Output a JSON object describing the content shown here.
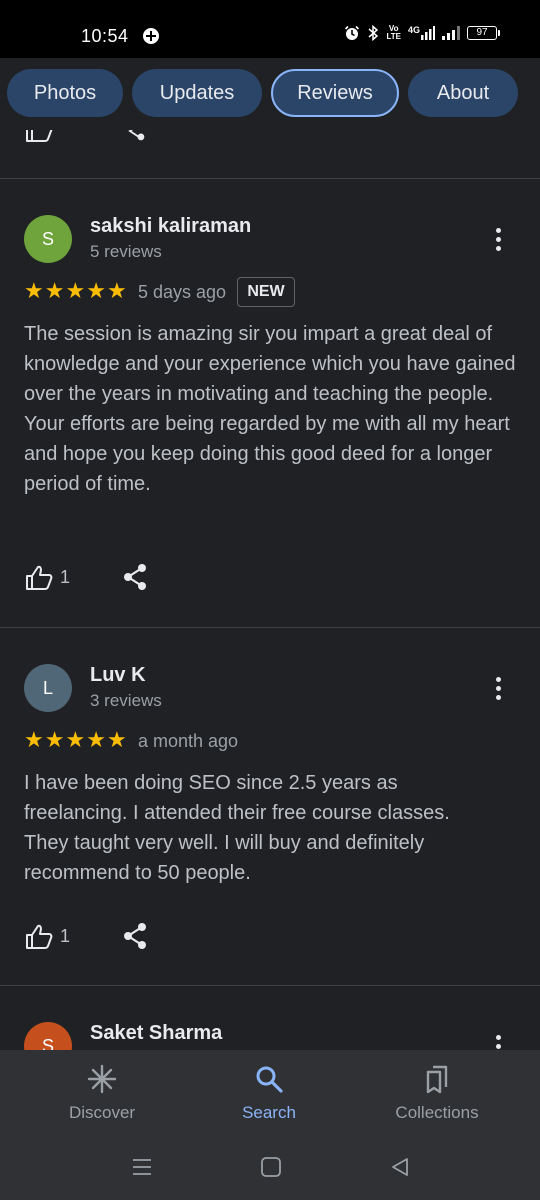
{
  "status_bar": {
    "time": "10:54",
    "volte_label_top": "Vo",
    "volte_label_bottom": "LTE",
    "network": "4G",
    "battery": "97"
  },
  "tabs": [
    {
      "label": "Photos",
      "active": false
    },
    {
      "label": "Updates",
      "active": false
    },
    {
      "label": "Reviews",
      "active": true
    },
    {
      "label": "About",
      "active": false
    }
  ],
  "prev_review": {
    "like_count": "1"
  },
  "reviews": [
    {
      "initial": "S",
      "avatar_color": "#6fa33b",
      "author": "sakshi kaliraman",
      "review_count": "5 reviews",
      "rating": 5,
      "when": "5 days ago",
      "badge": "NEW",
      "text": "The session is amazing sir you impart a great deal of knowledge and your experience which you have gained over the years in motivating and teaching the people.\nYour efforts are being regarded by me with all my heart and hope you keep doing this good deed for a longer period of time.",
      "like_count": "1"
    },
    {
      "initial": "L",
      "avatar_color": "#4f6777",
      "author": "Luv K",
      "review_count": "3 reviews",
      "rating": 5,
      "when": "a month ago",
      "text": "I have been doing SEO since 2.5 years as freelancing. I attended their free course classes. They taught very well. I will buy and definitely recommend to 50 people.",
      "like_count": "1"
    },
    {
      "initial": "S",
      "avatar_color": "#c5501d",
      "author": "Saket Sharma"
    }
  ],
  "bottom_nav": [
    {
      "label": "Discover",
      "icon": "discover-icon",
      "active": false
    },
    {
      "label": "Search",
      "icon": "search-icon",
      "active": true
    },
    {
      "label": "Collections",
      "icon": "collections-icon",
      "active": false
    }
  ],
  "colors": {
    "accent": "#8ab4f8",
    "star": "#fbbc04",
    "chip": "#2b4569",
    "background": "#202124"
  }
}
